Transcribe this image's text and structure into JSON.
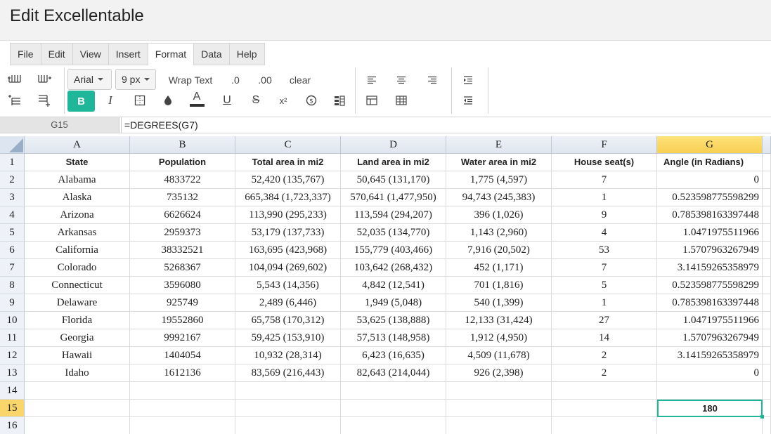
{
  "app": {
    "title": "Edit Excellentable"
  },
  "menu": [
    "File",
    "Edit",
    "View",
    "Insert",
    "Format",
    "Data",
    "Help"
  ],
  "active_menu": "Format",
  "toolbar": {
    "font": "Arial",
    "size": "9 px",
    "wrap": "Wrap Text",
    "dec_less": ".0",
    "dec_more": ".00",
    "clear": "clear",
    "bold": "B",
    "italic": "I",
    "font_color_letter": "A",
    "underline": "U",
    "strike": "S",
    "superscript": "x²",
    "icons": [
      "insert-column-left-icon",
      "insert-column-right-icon",
      "insert-row-above-icon",
      "insert-row-below-icon",
      "border-icon",
      "fill-color-icon",
      "currency-icon",
      "conditional-format-icon",
      "align-left-icon",
      "align-center-icon",
      "align-right-icon",
      "merge-cells-icon",
      "unmerge-cells-icon",
      "indent-increase-icon",
      "indent-decrease-icon"
    ],
    "accent": "#1fb69a"
  },
  "formula_bar": {
    "cell_ref": "G15",
    "formula": "=DEGREES(G7)"
  },
  "grid": {
    "columns": [
      "A",
      "B",
      "C",
      "D",
      "E",
      "F",
      "G"
    ],
    "selected_column": "G",
    "rows": [
      "1",
      "2",
      "3",
      "4",
      "5",
      "6",
      "7",
      "8",
      "9",
      "10",
      "11",
      "12",
      "13",
      "14",
      "15",
      "16"
    ],
    "selected_row": "15",
    "header": [
      "State",
      "Population",
      "Total area in mi2",
      "Land area in mi2",
      "Water area in mi2",
      "House seat(s)",
      "Angle (in Radians)"
    ],
    "data": [
      [
        "Alabama",
        "4833722",
        "52,420 (135,767)",
        "50,645 (131,170)",
        "1,775 (4,597)",
        "7",
        "0"
      ],
      [
        "Alaska",
        "735132",
        "665,384 (1,723,337)",
        "570,641 (1,477,950)",
        "94,743 (245,383)",
        "1",
        "0.523598775598299"
      ],
      [
        "Arizona",
        "6626624",
        "113,990 (295,233)",
        "113,594 (294,207)",
        "396 (1,026)",
        "9",
        "0.785398163397448"
      ],
      [
        "Arkansas",
        "2959373",
        "53,179 (137,733)",
        "52,035 (134,770)",
        "1,143 (2,960)",
        "4",
        "1.0471975511966"
      ],
      [
        "California",
        "38332521",
        "163,695 (423,968)",
        "155,779 (403,466)",
        "7,916 (20,502)",
        "53",
        "1.5707963267949"
      ],
      [
        "Colorado",
        "5268367",
        "104,094 (269,602)",
        "103,642 (268,432)",
        "452 (1,171)",
        "7",
        "3.14159265358979"
      ],
      [
        "Connecticut",
        "3596080",
        "5,543 (14,356)",
        "4,842 (12,541)",
        "701 (1,816)",
        "5",
        "0.523598775598299"
      ],
      [
        "Delaware",
        "925749",
        "2,489 (6,446)",
        "1,949 (5,048)",
        "540 (1,399)",
        "1",
        "0.785398163397448"
      ],
      [
        "Florida",
        "19552860",
        "65,758 (170,312)",
        "53,625 (138,888)",
        "12,133 (31,424)",
        "27",
        "1.0471975511966"
      ],
      [
        "Georgia",
        "9992167",
        "59,425 (153,910)",
        "57,513 (148,958)",
        "1,912 (4,950)",
        "14",
        "1.5707963267949"
      ],
      [
        "Hawaii",
        "1404054",
        "10,932 (28,314)",
        "6,423 (16,635)",
        "4,509 (11,678)",
        "2",
        "3.14159265358979"
      ],
      [
        "Idaho",
        "1612136",
        "83,569 (216,443)",
        "82,643 (214,044)",
        "926 (2,398)",
        "2",
        "0"
      ]
    ],
    "g15_value": "180"
  }
}
